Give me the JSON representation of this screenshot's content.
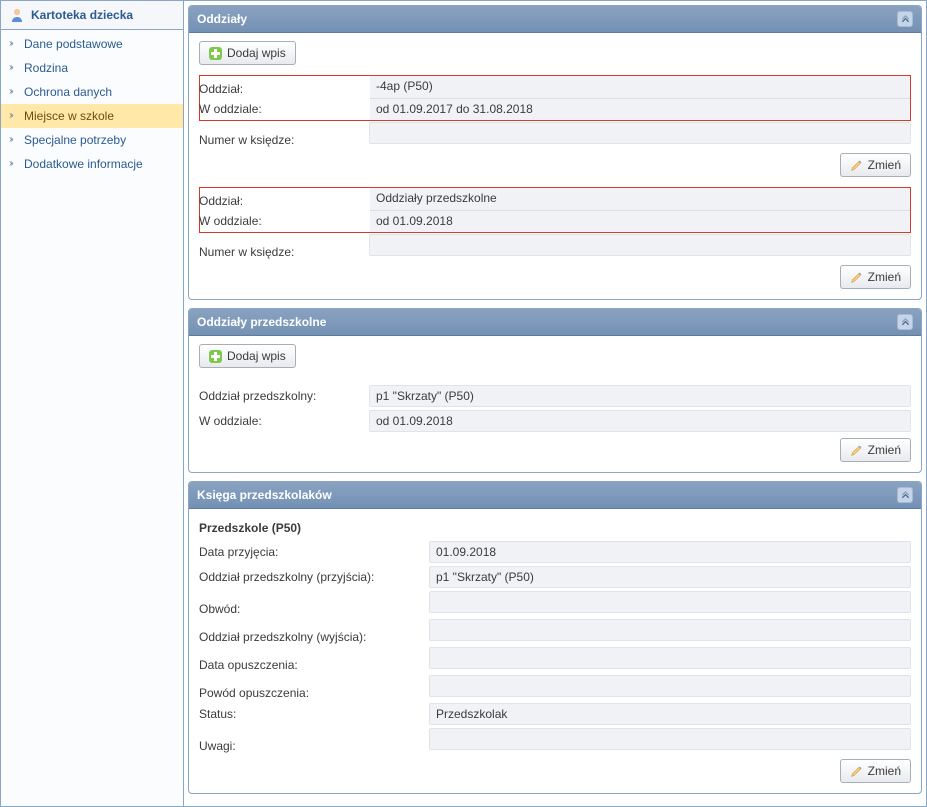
{
  "sidebar": {
    "title": "Kartoteka dziecka",
    "items": [
      {
        "label": "Dane podstawowe",
        "active": false
      },
      {
        "label": "Rodzina",
        "active": false
      },
      {
        "label": "Ochrona danych",
        "active": false
      },
      {
        "label": "Miejsce w szkole",
        "active": true
      },
      {
        "label": "Specjalne potrzeby",
        "active": false
      },
      {
        "label": "Dodatkowe informacje",
        "active": false
      }
    ]
  },
  "buttons": {
    "add_entry": "Dodaj wpis",
    "change": "Zmień"
  },
  "panels": {
    "oddzialy": {
      "title": "Oddziały",
      "entries": [
        {
          "labels": {
            "oddzial": "Oddział:",
            "w_oddziale": "W oddziale:",
            "numer": "Numer w księdze:"
          },
          "values": {
            "oddzial": "-4ap (P50)",
            "w_oddziale": "od 01.09.2017 do 31.08.2018",
            "numer": ""
          }
        },
        {
          "labels": {
            "oddzial": "Oddział:",
            "w_oddziale": "W oddziale:",
            "numer": "Numer w księdze:"
          },
          "values": {
            "oddzial": "Oddziały przedszkolne",
            "w_oddziale": "od 01.09.2018",
            "numer": ""
          }
        }
      ]
    },
    "oddzialy_przedszkolne": {
      "title": "Oddziały przedszkolne",
      "entry": {
        "labels": {
          "oddzial_p": "Oddział przedszkolny:",
          "w_oddziale": "W oddziale:"
        },
        "values": {
          "oddzial_p": "p1 \"Skrzaty\" (P50)",
          "w_oddziale": "od 01.09.2018"
        }
      }
    },
    "ksiega": {
      "title": "Księga przedszkolaków",
      "subsection": "Przedszkole (P50)",
      "rows": [
        {
          "label": "Data przyjęcia:",
          "value": "01.09.2018"
        },
        {
          "label": "Oddział przedszkolny (przyjścia):",
          "value": "p1 \"Skrzaty\" (P50)"
        },
        {
          "label": "Obwód:",
          "value": ""
        },
        {
          "label": "Oddział przedszkolny (wyjścia):",
          "value": ""
        },
        {
          "label": "Data opuszczenia:",
          "value": ""
        },
        {
          "label": "Powód opuszczenia:",
          "value": ""
        },
        {
          "label": "Status:",
          "value": "Przedszkolak"
        },
        {
          "label": "Uwagi:",
          "value": ""
        }
      ]
    }
  }
}
